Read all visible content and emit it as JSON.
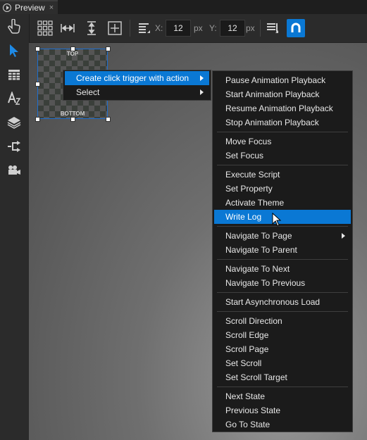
{
  "tab": {
    "title": "Preview",
    "close": "×"
  },
  "toolbar": {
    "x_label": "X:",
    "x_value": "12",
    "x_unit": "px",
    "y_label": "Y:",
    "y_value": "12",
    "y_unit": "px"
  },
  "widget": {
    "top_label": "TOP",
    "bottom_label": "BOTTOM"
  },
  "context_menu": {
    "items": [
      {
        "label": "Create click trigger with action"
      },
      {
        "label": "Select"
      }
    ]
  },
  "submenu": {
    "groups": [
      [
        "Pause Animation Playback",
        "Start Animation Playback",
        "Resume Animation Playback",
        "Stop Animation Playback"
      ],
      [
        "Move Focus",
        "Set Focus"
      ],
      [
        "Execute Script",
        "Set Property",
        "Activate Theme",
        "Write Log"
      ],
      [
        "Navigate To Page",
        "Navigate To Parent"
      ],
      [
        "Navigate To Next",
        "Navigate To Previous"
      ],
      [
        "Start Asynchronous Load"
      ],
      [
        "Scroll Direction",
        "Scroll Edge",
        "Scroll Page",
        "Set Scroll",
        "Set Scroll Target"
      ],
      [
        "Next State",
        "Previous State",
        "Go To State"
      ]
    ],
    "highlighted": "Write Log"
  },
  "colors": {
    "accent": "#0a78d4",
    "menu_bg": "#1b1b1b",
    "app_bg": "#2b2b2b"
  }
}
